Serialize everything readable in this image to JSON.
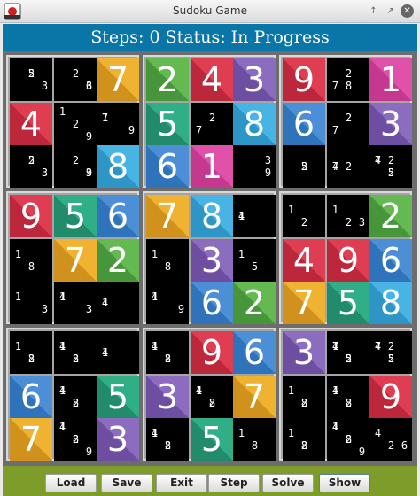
{
  "window": {
    "title": "Sudoku Game"
  },
  "status_bar": {
    "text": "Steps: 0 Status: In Progress"
  },
  "colors": {
    "1": [
      "#c4388f",
      "#e052aa"
    ],
    "2": [
      "#47963c",
      "#64ba50"
    ],
    "3": [
      "#6e4ea0",
      "#8c6cbe"
    ],
    "4": [
      "#bd273b",
      "#df3e52"
    ],
    "5": [
      "#218b6c",
      "#30ae86"
    ],
    "6": [
      "#2f74ba",
      "#4d8fd6"
    ],
    "7": [
      "#d0921c",
      "#f0b231"
    ],
    "8": [
      "#2e95c7",
      "#48b4e4"
    ],
    "9": [
      "#bd273b",
      "#df3e52"
    ]
  },
  "grid": [
    [
      "25/3",
      "2/36",
      "7",
      "2",
      "4",
      "3",
      "9",
      "2/78",
      "1"
    ],
    [
      "4",
      "1/2/9",
      "17/9",
      "5",
      "2/7",
      "8",
      "6",
      "2/7",
      "3"
    ],
    [
      "25/3",
      "2/39",
      "8",
      "6",
      "1",
      "3/9",
      "25",
      "247",
      "247/25"
    ],
    [
      "9",
      "5",
      "6",
      "7",
      "8",
      "14",
      "1/2",
      "1/23",
      "2"
    ],
    [
      "1/8",
      "7",
      "2",
      "1/8",
      "3",
      "1/5",
      "4",
      "9",
      "6"
    ],
    [
      "1/3",
      "14/3",
      "14",
      "14/9",
      "6",
      "2",
      "7",
      "5",
      "8"
    ],
    [
      "1/28",
      "14/28",
      "14",
      "14/28",
      "9",
      "6",
      "3",
      "147/25",
      "247/25"
    ],
    [
      "6",
      "14/28",
      "5",
      "3",
      "14/28",
      "7",
      "1/28",
      "14/28",
      "9"
    ],
    [
      "7",
      "14/28/9",
      "3",
      "14/28",
      "5",
      "1/8",
      "1/28",
      "14/28/9",
      "4/26"
    ]
  ],
  "buttons": [
    {
      "label": "Load"
    },
    {
      "label": "Save"
    },
    {
      "label": "Exit"
    },
    {
      "label": "Step"
    },
    {
      "label": "Solve"
    },
    {
      "label": "Show"
    }
  ]
}
